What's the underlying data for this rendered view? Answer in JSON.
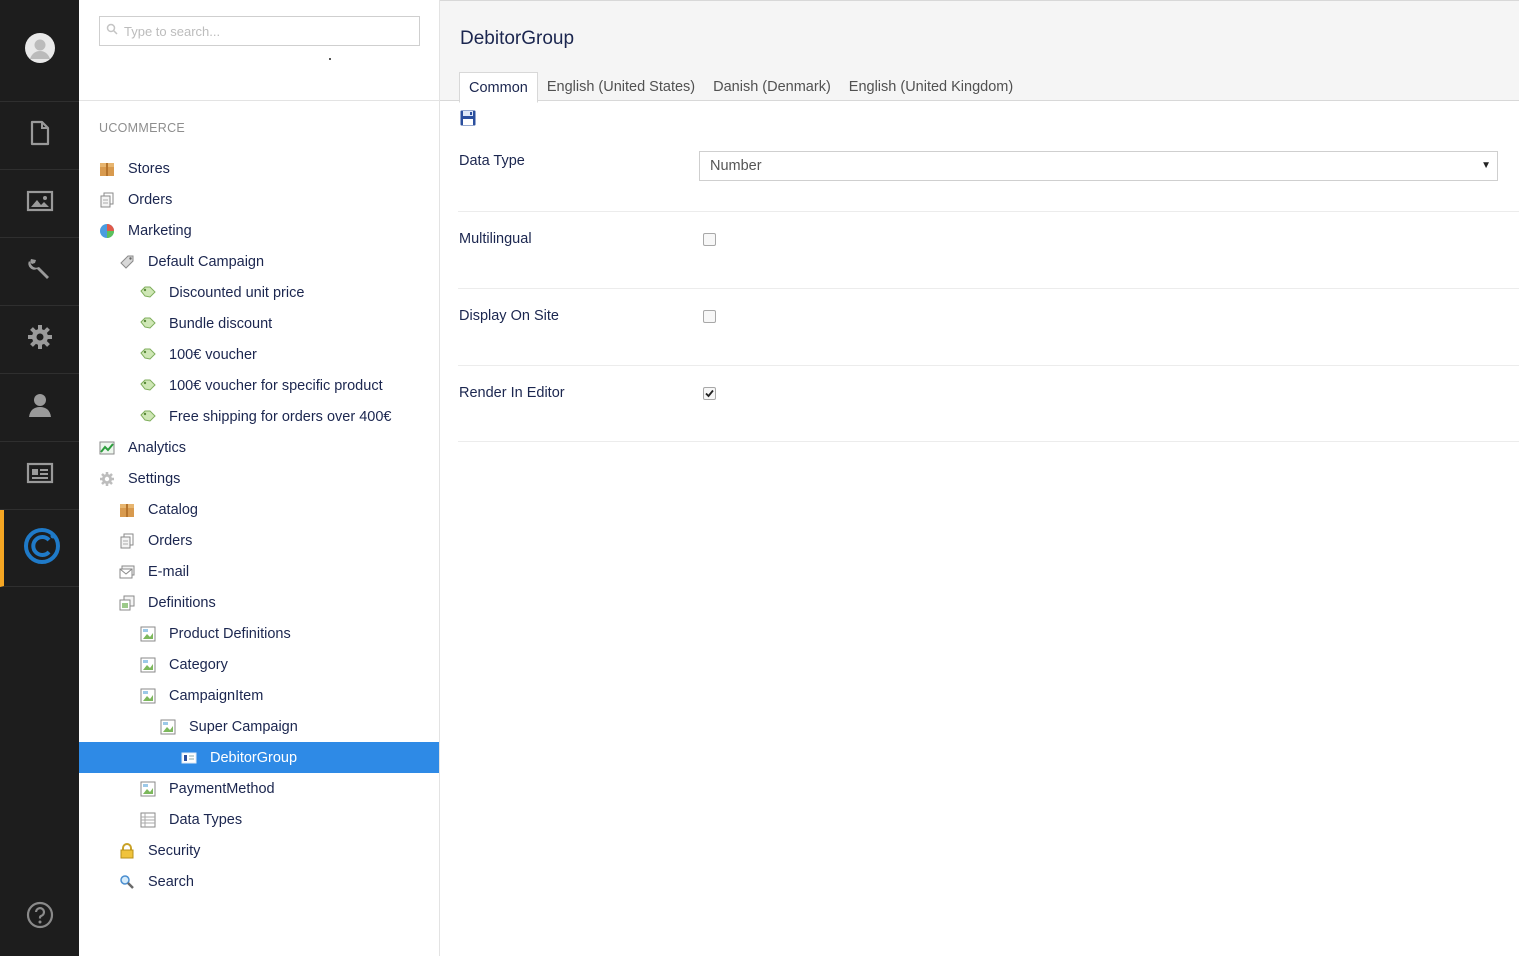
{
  "rail": {
    "items": [
      {
        "name": "rail-content",
        "icon": "document-icon"
      },
      {
        "name": "rail-media",
        "icon": "image-icon"
      },
      {
        "name": "rail-developer",
        "icon": "wrench-icon"
      },
      {
        "name": "rail-settings",
        "icon": "gear-icon"
      },
      {
        "name": "rail-users",
        "icon": "user-icon"
      },
      {
        "name": "rail-members",
        "icon": "id-card-icon"
      },
      {
        "name": "rail-ucommerce",
        "icon": "ucommerce-logo-icon"
      }
    ],
    "active_index": 6,
    "accent": "#f5a623"
  },
  "search": {
    "placeholder": "Type to search..."
  },
  "tree": {
    "section_title": "UCOMMERCE",
    "nodes": [
      {
        "label": "Stores",
        "level": 0,
        "icon": "package-icon"
      },
      {
        "label": "Orders",
        "level": 0,
        "icon": "orders-icon"
      },
      {
        "label": "Marketing",
        "level": 0,
        "icon": "pie-chart-icon"
      },
      {
        "label": "Default Campaign",
        "level": 1,
        "icon": "tag-icon"
      },
      {
        "label": "Discounted unit price",
        "level": 2,
        "icon": "green-tag-icon"
      },
      {
        "label": "Bundle discount",
        "level": 2,
        "icon": "green-tag-icon"
      },
      {
        "label": "100€ voucher",
        "level": 2,
        "icon": "green-tag-icon"
      },
      {
        "label": "100€ voucher for specific product",
        "level": 2,
        "icon": "green-tag-icon"
      },
      {
        "label": "Free shipping for orders over 400€",
        "level": 2,
        "icon": "green-tag-icon"
      },
      {
        "label": "Analytics",
        "level": 0,
        "icon": "analytics-icon"
      },
      {
        "label": "Settings",
        "level": 0,
        "icon": "settings-gear-icon"
      },
      {
        "label": "Catalog",
        "level": 1,
        "icon": "package-icon"
      },
      {
        "label": "Orders",
        "level": 1,
        "icon": "orders-icon"
      },
      {
        "label": "E-mail",
        "level": 1,
        "icon": "email-icon"
      },
      {
        "label": "Definitions",
        "level": 1,
        "icon": "definitions-icon"
      },
      {
        "label": "Product Definitions",
        "level": 2,
        "icon": "definition-icon"
      },
      {
        "label": "Category",
        "level": 2,
        "icon": "definition-icon"
      },
      {
        "label": "CampaignItem",
        "level": 2,
        "icon": "definition-icon"
      },
      {
        "label": "Super Campaign",
        "level": 3,
        "icon": "definition-icon"
      },
      {
        "label": "DebitorGroup",
        "level": 4,
        "icon": "field-icon",
        "selected": true
      },
      {
        "label": "PaymentMethod",
        "level": 2,
        "icon": "definition-icon"
      },
      {
        "label": "Data Types",
        "level": 2,
        "icon": "data-types-icon"
      },
      {
        "label": "Security",
        "level": 1,
        "icon": "lock-icon"
      },
      {
        "label": "Search",
        "level": 1,
        "icon": "magnifier-icon"
      }
    ],
    "selected_color": "#2e8ae6"
  },
  "main": {
    "title": "DebitorGroup",
    "tabs": [
      "Common",
      "English (United States)",
      "Danish (Denmark)",
      "English (United Kingdom)"
    ],
    "active_tab": 0,
    "fields": {
      "data_type": {
        "label": "Data Type",
        "value": "Number"
      },
      "multilingual": {
        "label": "Multilingual",
        "checked": false
      },
      "display_on_site": {
        "label": "Display On Site",
        "checked": false
      },
      "render_in_editor": {
        "label": "Render In Editor",
        "checked": true
      }
    }
  }
}
